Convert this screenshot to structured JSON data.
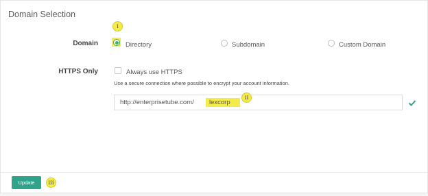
{
  "section": {
    "title": "Domain Selection"
  },
  "domain": {
    "label": "Domain",
    "options": [
      {
        "label": "Directory",
        "checked": true
      },
      {
        "label": "Subdomain",
        "checked": false
      },
      {
        "label": "Custom Domain",
        "checked": false
      }
    ]
  },
  "https": {
    "label": "HTTPS Only",
    "checkbox_label": "Always use HTTPS",
    "checked": false,
    "help": "Use a secure connection where possible to encrypt your account information."
  },
  "url": {
    "prefix": "http://enterprisetube.com/",
    "value": "lexcorp",
    "valid_icon": "check-icon"
  },
  "annotations": {
    "i": "i",
    "ii": "ii",
    "iii": "iii"
  },
  "footer": {
    "update_label": "Update"
  },
  "colors": {
    "accent": "#2fa48b",
    "highlight": "#f3eb4a",
    "radio_checked": "#3cb371"
  }
}
